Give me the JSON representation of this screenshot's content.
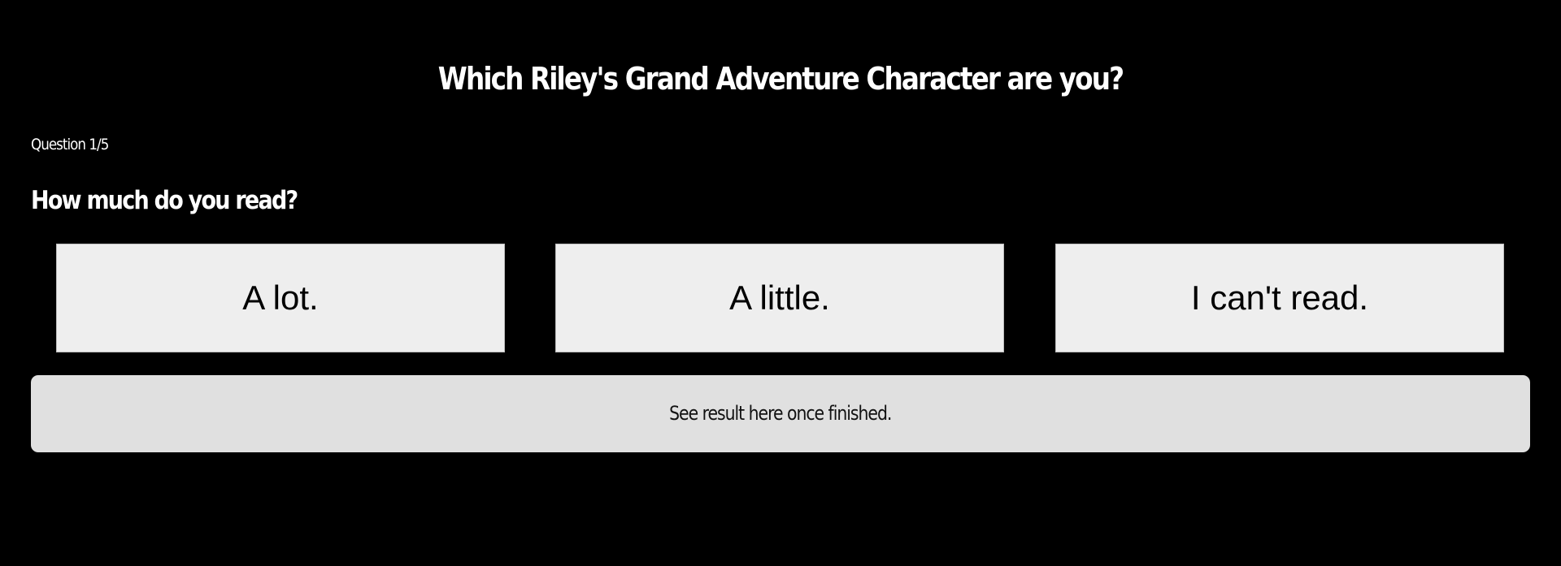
{
  "quiz": {
    "title": "Which Riley's Grand Adventure Character are you?",
    "question_counter": "Question 1/5",
    "question": "How much do you read?",
    "answers": [
      {
        "label": "A lot."
      },
      {
        "label": "A little."
      },
      {
        "label": "I can't read."
      }
    ],
    "result_placeholder": "See result here once finished."
  },
  "colors": {
    "background": "#000000",
    "text": "#ffffff",
    "answer_button_bg": "#eeeeee",
    "result_box_bg": "#e0e0e0"
  }
}
